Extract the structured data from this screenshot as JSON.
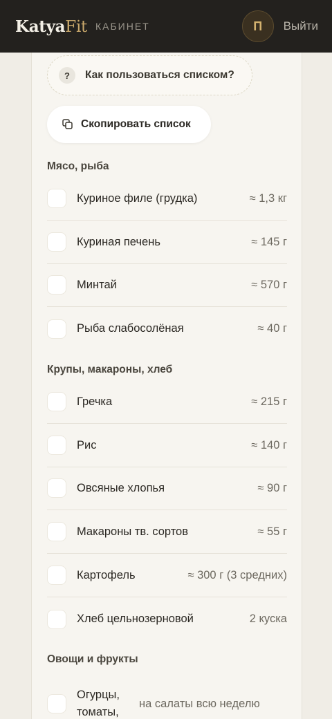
{
  "header": {
    "brand_main": "Katya",
    "brand_accent": "Fit",
    "section": "КАБИНЕТ",
    "avatar_initial": "П",
    "logout_label": "Выйти"
  },
  "actions": {
    "help_icon": "?",
    "help_label": "Как пользоваться списком?",
    "copy_label": "Скопировать список"
  },
  "categories": [
    {
      "title": "Мясо, рыба",
      "items": [
        {
          "name": "Куриное филе (грудка)",
          "qty": "≈ 1,3 кг"
        },
        {
          "name": "Куриная печень",
          "qty": "≈ 145 г"
        },
        {
          "name": "Минтай",
          "qty": "≈ 570 г"
        },
        {
          "name": "Рыба слабосолёная",
          "qty": "≈ 40 г"
        }
      ]
    },
    {
      "title": "Крупы, макароны, хлеб",
      "items": [
        {
          "name": "Гречка",
          "qty": "≈ 215 г"
        },
        {
          "name": "Рис",
          "qty": "≈ 140 г"
        },
        {
          "name": "Овсяные хлопья",
          "qty": "≈ 90 г"
        },
        {
          "name": "Макароны тв. сортов",
          "qty": "≈ 55 г"
        },
        {
          "name": "Картофель",
          "qty": "≈ 300 г (3 средних)"
        },
        {
          "name": "Хлеб цельнозерновой",
          "qty": "2 куска"
        }
      ]
    },
    {
      "title": "Овощи и фрукты",
      "items": [
        {
          "name": "Огурцы, томаты,",
          "qty": "на салаты всю неделю"
        }
      ]
    }
  ],
  "colors": {
    "header_bg": "#23211e",
    "accent_gold": "#c9a86b",
    "page_bg": "#f0ede6",
    "panel_bg": "#f7f5f0"
  }
}
